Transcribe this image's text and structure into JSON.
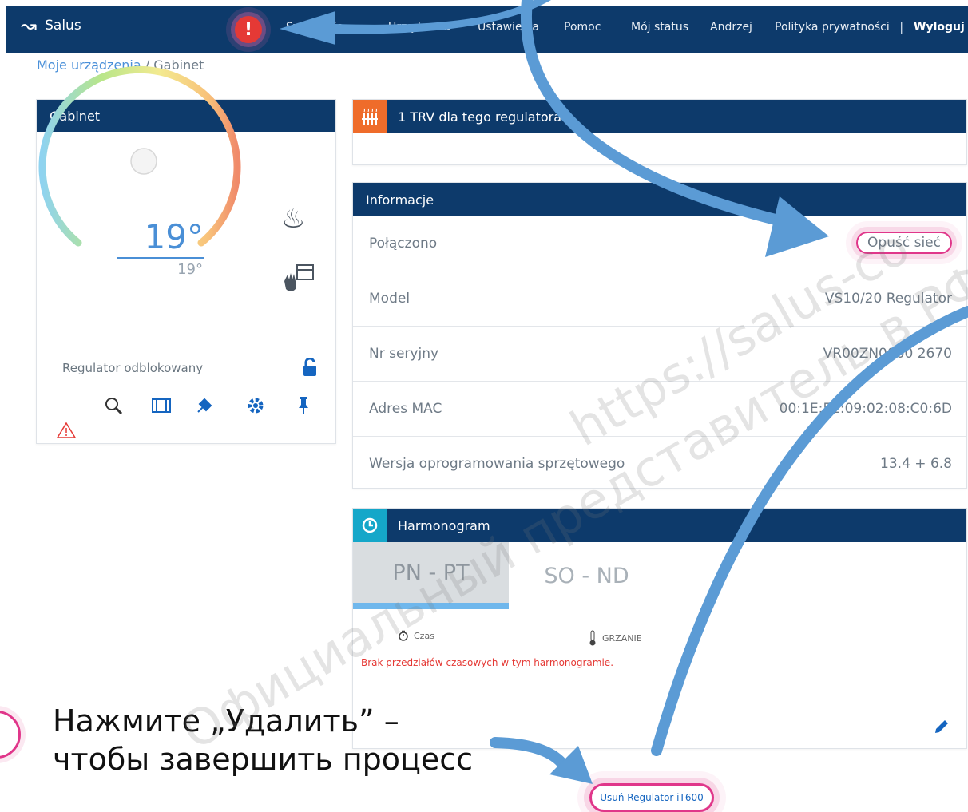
{
  "topbar": {
    "brand": "Salus",
    "nav": [
      "Symulacja",
      "Urządzenia",
      "Ustawienia",
      "Pomoc",
      "Mój status",
      "Andrzej",
      "Polityka prywatności",
      "|",
      "Wyloguj"
    ]
  },
  "breadcrumb": {
    "root": "Moje urządzenia",
    "separator": "/",
    "current": "Gabinet"
  },
  "thermostat": {
    "title": "Gabinet",
    "current_temp": "19°",
    "set_temp": "19°",
    "status": "Regulator odblokowany"
  },
  "trv": {
    "title": "1 TRV dla tego regulatora"
  },
  "info": {
    "title": "Informacje",
    "rows": [
      {
        "label": "Połączono",
        "value": "Opuść sieć"
      },
      {
        "label": "Model",
        "value": "VS10/20 Regulator"
      },
      {
        "label": "Nr seryjny",
        "value": "VR00ZN0000 2670"
      },
      {
        "label": "Adres MAC",
        "value": "00:1E:5E:09:02:08:C0:6D"
      },
      {
        "label": "Wersja oprogramowania sprzętowego",
        "value": "13.4 + 6.8"
      }
    ]
  },
  "schedule": {
    "title": "Harmonogram",
    "tabs": [
      "PN - PT",
      "SO - ND"
    ],
    "col_time": "Czas",
    "col_heat": "GRZANIE",
    "empty_message": "Brak przedziałów czasowych w tym harmonogramie."
  },
  "remove_button": "Usuń Regulator iT600",
  "instruction": {
    "line1": "Нажмите „Удалить” –",
    "line2": "чтобы завершить процесс"
  },
  "watermarks": [
    "https://salus-co",
    "Официальный представитель в РФ"
  ],
  "colors": {
    "header": "#0d3a6b",
    "accent": "#1565c0",
    "highlight": "#e0368a",
    "arrow": "#5b9bd5",
    "error": "#e53935"
  }
}
